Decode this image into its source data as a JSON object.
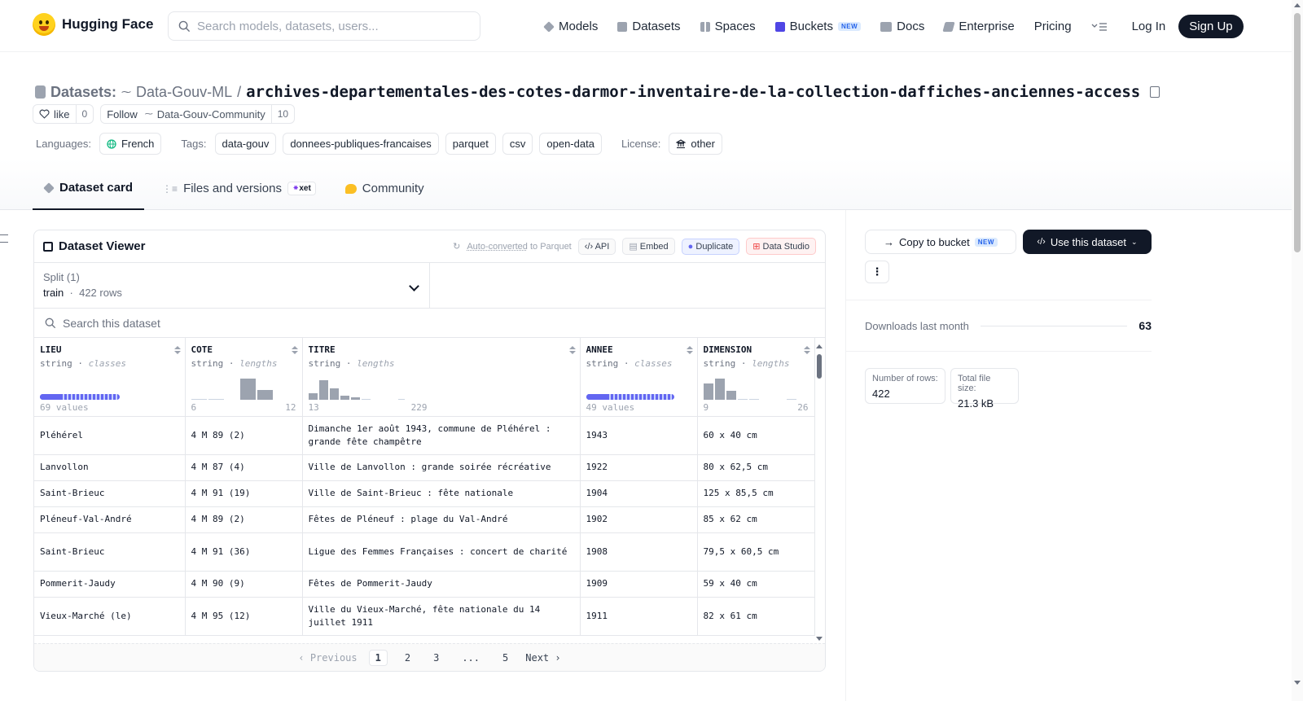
{
  "header": {
    "brand": "Hugging Face",
    "search_placeholder": "Search models, datasets, users...",
    "nav": {
      "models": "Models",
      "datasets": "Datasets",
      "spaces": "Spaces",
      "buckets": "Buckets",
      "buckets_badge": "NEW",
      "docs": "Docs",
      "enterprise": "Enterprise",
      "pricing": "Pricing"
    },
    "login": "Log In",
    "signup": "Sign Up"
  },
  "repo": {
    "section": "Datasets:",
    "owner": "Data-Gouv-ML",
    "separator": "/",
    "name": "archives-departementales-des-cotes-darmor-inventaire-de-la-collection-daffiches-anciennes-access",
    "like_label": "like",
    "like_count": "0",
    "follow_label": "Follow",
    "follow_org": "Data-Gouv-Community",
    "follow_count": "10"
  },
  "meta": {
    "languages_label": "Languages:",
    "language": "French",
    "tags_label": "Tags:",
    "tags": [
      "data-gouv",
      "donnees-publiques-francaises",
      "parquet",
      "csv",
      "open-data"
    ],
    "license_label": "License:",
    "license": "other"
  },
  "tabs": {
    "card": "Dataset card",
    "files": "Files and versions",
    "xet": "xet",
    "community": "Community"
  },
  "viewer": {
    "title": "Dataset Viewer",
    "auto_converted": "Auto-converted",
    "to_parquet": "to Parquet",
    "api": "API",
    "embed": "Embed",
    "duplicate": "Duplicate",
    "data_studio": "Data Studio",
    "split_label": "Split (1)",
    "split_name": "train",
    "split_rows": "422 rows",
    "search_placeholder": "Search this dataset",
    "columns": [
      {
        "name": "LIEU",
        "type": "string",
        "kind": "classes",
        "min": "69 values",
        "max": ""
      },
      {
        "name": "COTE",
        "type": "string",
        "kind": "lengths",
        "min": "6",
        "max": "12"
      },
      {
        "name": "TITRE",
        "type": "string",
        "kind": "lengths",
        "min": "13",
        "max": "229"
      },
      {
        "name": "ANNEE",
        "type": "string",
        "kind": "classes",
        "min": "49 values",
        "max": ""
      },
      {
        "name": "DIMENSION",
        "type": "string",
        "kind": "lengths",
        "min": "9",
        "max": "26"
      }
    ],
    "rows": [
      [
        "Pléhérel",
        "4 M 89 (2)",
        "Dimanche 1er août 1943, commune de Pléhérel : grande fête champêtre",
        "1943",
        "60 x 40 cm"
      ],
      [
        "Lanvollon",
        "4 M 87 (4)",
        "Ville de Lanvollon : grande soirée récréative",
        "1922",
        "80 x 62,5 cm"
      ],
      [
        "Saint-Brieuc",
        "4 M 91 (19)",
        "Ville de Saint-Brieuc : fête nationale",
        "1904",
        "125 x 85,5 cm"
      ],
      [
        "Pléneuf-Val-André",
        "4 M 89 (2)",
        "Fêtes de Pléneuf : plage du Val-André",
        "1902",
        "85 x 62 cm"
      ],
      [
        "Saint-Brieuc",
        "4 M 91 (36)",
        "Ligue des Femmes Françaises : concert de charité",
        "1908",
        "79,5 x 60,5 cm"
      ],
      [
        "Pommerit-Jaudy",
        "4 M 90 (9)",
        "Fêtes de Pommerit-Jaudy",
        "1909",
        "59 x 40 cm"
      ],
      [
        "Vieux-Marché (le)",
        "4 M 95 (12)",
        "Ville du Vieux-Marché, fête nationale du 14 juillet 1911",
        "1911",
        "82 x 61 cm"
      ]
    ],
    "pager": {
      "previous": "Previous",
      "pages": [
        "1",
        "2",
        "3",
        "...",
        "5"
      ],
      "next": "Next",
      "current": "1"
    }
  },
  "sidebar": {
    "copy_bucket": "Copy to bucket",
    "copy_badge": "NEW",
    "use_dataset": "Use this dataset",
    "downloads_label": "Downloads last month",
    "downloads": "63",
    "rows_label": "Number of rows:",
    "rows": "422",
    "size_label": "Total file size:",
    "size": "21.3 kB"
  },
  "icons": {
    "search": "search-icon",
    "copy": "copy-icon",
    "heart": "heart-icon",
    "globe": "globe-icon",
    "license": "bank-icon",
    "chevron": "chevron-down-icon"
  },
  "colors": {
    "accent": "#6366f1",
    "dark": "#111827",
    "brand": "#ffd21e"
  }
}
